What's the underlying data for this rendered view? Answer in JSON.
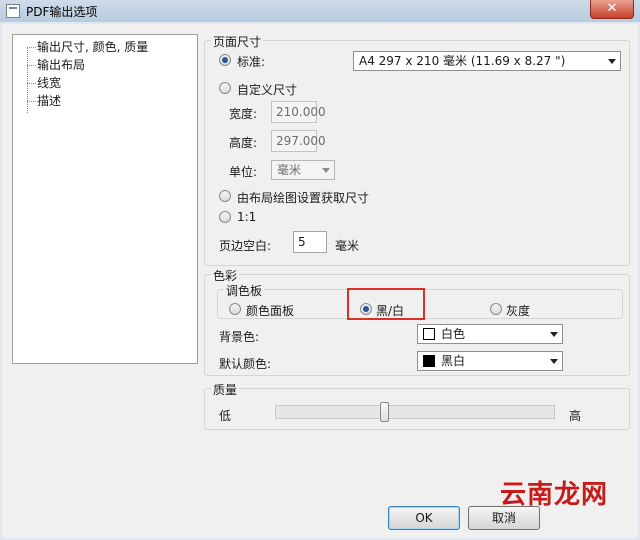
{
  "window": {
    "title": "PDF输出选项",
    "close_glyph": "✕",
    "icon": "pdf-document-icon"
  },
  "tree": {
    "items": [
      {
        "label": "输出尺寸, 颜色, 质量"
      },
      {
        "label": "输出布局"
      },
      {
        "label": "线宽"
      },
      {
        "label": "描述"
      }
    ]
  },
  "page_size": {
    "group_label": "页面尺寸",
    "standard_label": "标准:",
    "standard_selected": true,
    "standard_combo_value": "A4 297 x 210 毫米 (11.69 x 8.27 \")",
    "custom_label": "自定义尺寸",
    "width_label": "宽度:",
    "width_value": "210.000",
    "height_label": "高度:",
    "height_value": "297.000",
    "unit_label": "单位:",
    "unit_value": "毫米",
    "from_layout_label": "由布局绘图设置获取尺寸",
    "one_to_one_label": "1:1",
    "margin_label": "页边空白:",
    "margin_value": "5",
    "margin_unit": "毫米"
  },
  "color": {
    "group_label": "色彩",
    "palette_label": "调色板",
    "palette_options": [
      {
        "label": "颜色面板",
        "selected": false
      },
      {
        "label": "黑/白",
        "selected": true
      },
      {
        "label": "灰度",
        "selected": false
      }
    ],
    "background_label": "背景色:",
    "background_value": "白色",
    "background_swatch": "#ffffff",
    "default_color_label": "默认颜色:",
    "default_color_value": "黑白",
    "default_color_swatch": "#000000",
    "highlight_color": "#d9302a"
  },
  "quality": {
    "group_label": "质量",
    "low_label": "低",
    "high_label": "高",
    "level": 0.39
  },
  "buttons": {
    "ok_label": "OK",
    "cancel_label": "取消"
  },
  "watermark": {
    "text": "云南龙网"
  }
}
